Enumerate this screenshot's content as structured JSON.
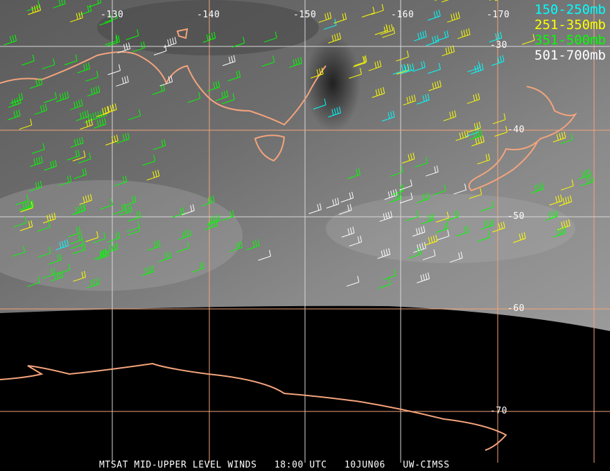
{
  "lon_labels": [
    "-130",
    "-140",
    "-150",
    "-160",
    "-170"
  ],
  "lat_labels": [
    "-30",
    "-40",
    "-50",
    "-60",
    "-70"
  ],
  "legend": [
    {
      "label": "150-250mb",
      "color": "#00ffff"
    },
    {
      "label": "251-350mb",
      "color": "#ffff00"
    },
    {
      "label": "351-500mb",
      "color": "#00ff00"
    },
    {
      "label": "501-700mb",
      "color": "#ffffff"
    }
  ],
  "caption": {
    "product": "MTSAT MID-UPPER LEVEL WINDS",
    "time": "18:00 UTC",
    "date": "10JUN06",
    "source": "UW-CIMSS"
  },
  "colors": {
    "coast": "#f4a47c",
    "grid_orange": "#f4a47c",
    "grid_white": "#d8d8d8"
  }
}
